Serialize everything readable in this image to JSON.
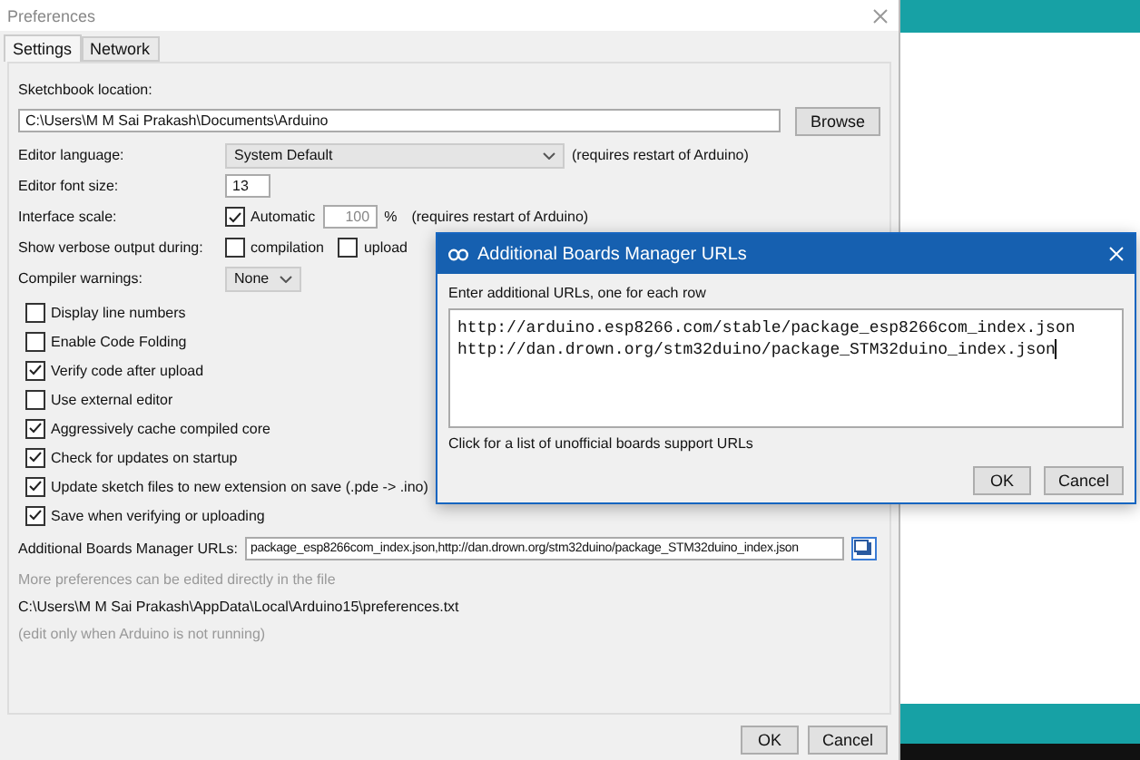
{
  "window": {
    "title": "Preferences"
  },
  "tabs": [
    {
      "label": "Settings",
      "selected": true
    },
    {
      "label": "Network",
      "selected": false
    }
  ],
  "sketchbook": {
    "label": "Sketchbook location:",
    "value": "C:\\Users\\M M Sai Prakash\\Documents\\Arduino",
    "button": "Browse"
  },
  "editor_language": {
    "label": "Editor language:",
    "value": "System Default",
    "note": "(requires restart of Arduino)"
  },
  "editor_font_size": {
    "label": "Editor font size:",
    "value": "13"
  },
  "interface_scale": {
    "label": "Interface scale:",
    "automatic_label": "Automatic",
    "automatic_checked": true,
    "value": "100",
    "unit": "%",
    "note": "(requires restart of Arduino)"
  },
  "verbose_output": {
    "label": "Show verbose output during:",
    "options": [
      {
        "label": "compilation",
        "checked": false
      },
      {
        "label": "upload",
        "checked": false
      }
    ]
  },
  "compiler_warnings": {
    "label": "Compiler warnings:",
    "value": "None"
  },
  "options": [
    {
      "label": "Display line numbers",
      "checked": false
    },
    {
      "label": "Enable Code Folding",
      "checked": false
    },
    {
      "label": "Verify code after upload",
      "checked": true
    },
    {
      "label": "Use external editor",
      "checked": false
    },
    {
      "label": "Aggressively cache compiled core",
      "checked": true
    },
    {
      "label": "Check for updates on startup",
      "checked": true
    },
    {
      "label": "Update sketch files to new extension on save (.pde -> .ino)",
      "checked": true
    },
    {
      "label": "Save when verifying or uploading",
      "checked": true
    }
  ],
  "boards_urls": {
    "label": "Additional Boards Manager URLs:",
    "value": "package_esp8266com_index.json,http://dan.drown.org/stm32duino/package_STM32duino_index.json"
  },
  "notes": {
    "hint": "More preferences can be edited directly in the file",
    "path": "C:\\Users\\M M Sai Prakash\\AppData\\Local\\Arduino15\\preferences.txt",
    "warning": "(edit only when Arduino is not running)"
  },
  "buttons": [
    "OK",
    "Cancel"
  ],
  "dialog": {
    "title": "Additional Boards Manager URLs",
    "prompt": "Enter additional URLs, one for each row",
    "urls": [
      "http://arduino.esp8266.com/stable/package_esp8266com_index.json",
      "http://dan.drown.org/stm32duino/package_STM32duino_index.json"
    ],
    "link": "Click for a list of unofficial boards support URLs",
    "buttons": [
      "OK",
      "Cancel"
    ]
  }
}
